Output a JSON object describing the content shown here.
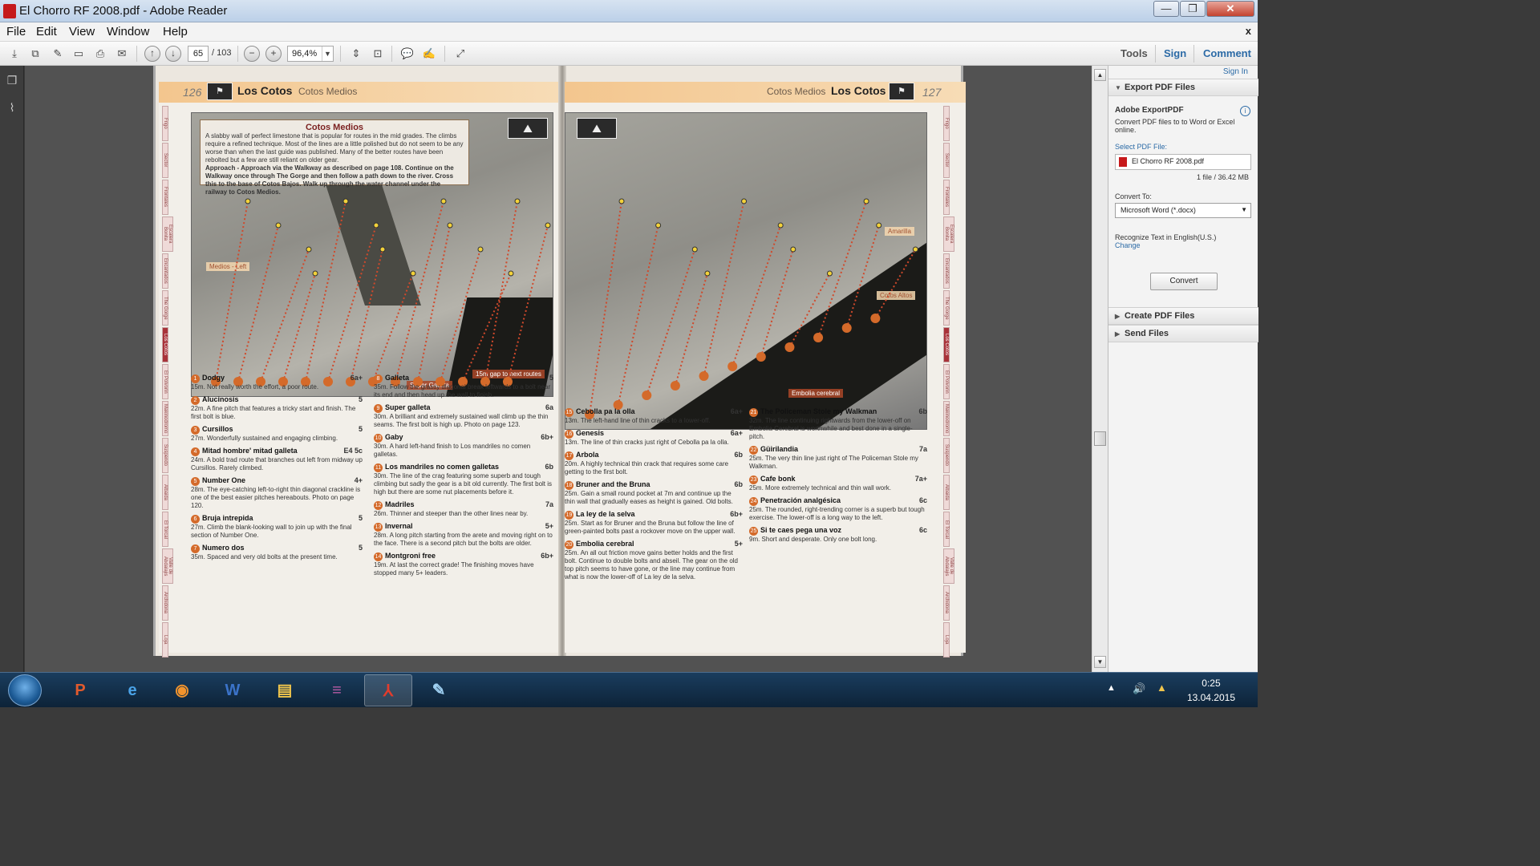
{
  "window": {
    "title": "El Chorro RF 2008.pdf - Adobe Reader",
    "min": "—",
    "max": "❐",
    "close": "✕"
  },
  "menu": {
    "items": [
      "File",
      "Edit",
      "View",
      "Window",
      "Help"
    ],
    "close_doc": "x"
  },
  "toolbar": {
    "page_current": "65",
    "page_total": "/ 103",
    "zoom": "96,4%",
    "tools": "Tools",
    "sign": "Sign",
    "comment": "Comment"
  },
  "document": {
    "left": {
      "page_number": "126",
      "title": "Los Cotos",
      "subtitle": "Cotos Medios",
      "info_title": "Cotos Medios",
      "info_text": "A slabby wall of perfect limestone that is popular for routes in the mid grades. The climbs require a refined technique. Most of the lines are a little polished but do not seem to be any worse than when the last guide was published. Many of the better routes have been rebolted but a few are still reliant on older gear.",
      "info_approach": "Approach - Approach via the Walkway as described on page 108. Continue on the Walkway once through The Gorge and then follow a path down to the river. Cross this to the base of Cotos Bajos. Walk up through the water channel under the railway to Cotos Medios.",
      "tag_left": "Medios - Left",
      "tag_gap": "15m gap to next routes",
      "tag_super": "Super Galleta",
      "routes_col1": [
        {
          "num": "1",
          "name": "Dodgy",
          "grade": "6a+",
          "desc": "15m. Not really worth the effort, a poor route."
        },
        {
          "num": "2",
          "name": "Alucinosis",
          "grade": "5",
          "desc": "22m. A fine pitch that features a tricky start and finish. The first bolt is blue."
        },
        {
          "num": "3",
          "name": "Cursillos",
          "grade": "5",
          "desc": "27m. Wonderfully sustained and engaging climbing."
        },
        {
          "num": "4",
          "name": "Mitad hombre' mitad galleta",
          "grade": "E4 5c",
          "desc": "24m. A bold trad route that branches out left from midway up Cursillos. Rarely climbed."
        },
        {
          "num": "5",
          "name": "Number One",
          "grade": "4+",
          "desc": "28m. The eye-catching left-to-right thin diagonal crackline is one of the best easier pitches hereabouts. Photo on page 120."
        },
        {
          "num": "6",
          "name": "Bruja intrepida",
          "grade": "5",
          "desc": "27m. Climb the blank-looking wall to join up with the final section of Number One."
        },
        {
          "num": "7",
          "name": "Numero dos",
          "grade": "5",
          "desc": "35m. Spaced and very old bolts at the present time."
        }
      ],
      "routes_col2": [
        {
          "num": "8",
          "name": "Galleta",
          "grade": "5",
          "desc": "35m. Follow the grassy diagonal break leftwards to a bolt near its end and then head up the wall to finish."
        },
        {
          "num": "9",
          "name": "Super galleta",
          "grade": "6a",
          "desc": "30m. A brilliant and extremely sustained wall climb up the thin seams. The first bolt is high up. Photo on page 123."
        },
        {
          "num": "10",
          "name": "Gaby",
          "grade": "6b+",
          "desc": "30m. A hard left-hand finish to Los mandriles no comen galletas."
        },
        {
          "num": "11",
          "name": "Los mandriles no comen galletas",
          "grade": "6b",
          "desc": "30m. The line of the crag featuring some superb and tough climbing but sadly the gear is a bit old currently. The first bolt is high but there are some nut placements before it."
        },
        {
          "num": "12",
          "name": "Madriles",
          "grade": "7a",
          "desc": "26m. Thinner and steeper than the other lines near by."
        },
        {
          "num": "13",
          "name": "Invernal",
          "grade": "5+",
          "desc": "28m. A long pitch starting from the arete and moving right on to the face. There is a second pitch but the bolts are older."
        },
        {
          "num": "14",
          "name": "Montgroni free",
          "grade": "6b+",
          "desc": "19m. At last the correct grade! The finishing moves have stopped many 5+ leaders."
        }
      ]
    },
    "right": {
      "page_number": "127",
      "title": "Los Cotos",
      "subtitle": "Cotos Medios",
      "tag_amarilla": "Amarilla",
      "tag_altos": "Cotos Altos",
      "tag_embolia": "Embolia cerebral",
      "routes_col1": [
        {
          "num": "15",
          "name": "Cebolla pa la olla",
          "grade": "6a+",
          "desc": "13m. The left-hand line of thin cracks to a lower-off."
        },
        {
          "num": "16",
          "name": "Genesis",
          "grade": "6a+",
          "desc": "13m. The line of thin cracks just right of Cebolla pa la olla."
        },
        {
          "num": "17",
          "name": "Arbola",
          "grade": "6b",
          "desc": "20m. A highly technical thin crack that requires some care getting to the first bolt."
        },
        {
          "num": "18",
          "name": "Bruner and the Bruna",
          "grade": "6b",
          "desc": "25m. Gain a small round pocket at 7m and continue up the thin wall that gradually eases as height is gained. Old bolts."
        },
        {
          "num": "19",
          "name": "La ley de la selva",
          "grade": "6b+",
          "desc": "25m. Start as for Bruner and the Bruna but follow the line of green-painted bolts past a rockover move on the upper wall."
        },
        {
          "num": "20",
          "name": "Embolia cerebral",
          "grade": "5+",
          "desc": "25m. An all out friction move gains better holds and the first bolt. Continue to double bolts and abseil. The gear on the old top pitch seems to have gone, or the line may continue from what is now the lower-off of La ley de la selva."
        }
      ],
      "routes_col2": [
        {
          "num": "21",
          "name": "The Policeman Stole my Walkman",
          "grade": "6b",
          "desc": "32m. The line continuing rightwards from the lower-off on Embolia Cerebral is worthwhile and best done in a single-pitch."
        },
        {
          "num": "22",
          "name": "Güirilandia",
          "grade": "7a",
          "desc": "25m. The very thin line just right of The Policeman Stole my Walkman."
        },
        {
          "num": "23",
          "name": "Cafe bonk",
          "grade": "7a+",
          "desc": "25m. More extremely technical and thin wall work."
        },
        {
          "num": "24",
          "name": "Penetración analgésica",
          "grade": "6c",
          "desc": "25m. The rounded, right-trending corner is a superb but tough exercise. The lower-off is a long way to the left."
        },
        {
          "num": "25",
          "name": "Si te caes pega una voz",
          "grade": "6c",
          "desc": "9m. Short and desperate. Only one bolt long."
        }
      ]
    }
  },
  "sidebar_tabs": [
    "Frigo",
    "Sector",
    "Frontales",
    "Escalera Bonita",
    "Encantados",
    "The Gorge",
    "Los Cotos",
    "El Polvorin",
    "Makinodromo",
    "Suspendo",
    "Albaida",
    "El Torcal",
    "Valle de Abdalajis",
    "Archidona",
    "Loja"
  ],
  "right_panel": {
    "sign_in": "Sign In",
    "export_header": "Export PDF Files",
    "export_title": "Adobe ExportPDF",
    "export_desc": "Convert PDF files to to Word or Excel online.",
    "select_label": "Select PDF File:",
    "file_name": "El Chorro RF 2008.pdf",
    "file_meta": "1 file / 36.42 MB",
    "convert_to_label": "Convert To:",
    "convert_to_value": "Microsoft Word (*.docx)",
    "recognize_text": "Recognize Text in English(U.S.)",
    "change_link": "Change",
    "convert_button": "Convert",
    "create_header": "Create PDF Files",
    "send_header": "Send Files"
  },
  "taskbar": {
    "apps": [
      "PowerPoint",
      "Internet Explorer",
      "Firefox",
      "Word",
      "Explorer",
      "WinRAR",
      "Adobe Reader",
      "Paint"
    ],
    "time": "0:25",
    "date": "13.04.2015"
  },
  "colors": {
    "accent_blue": "#2b6aa6",
    "reader_red": "#c5191b",
    "route_orange": "#d46a2a",
    "header_band": "#f3c68e"
  }
}
